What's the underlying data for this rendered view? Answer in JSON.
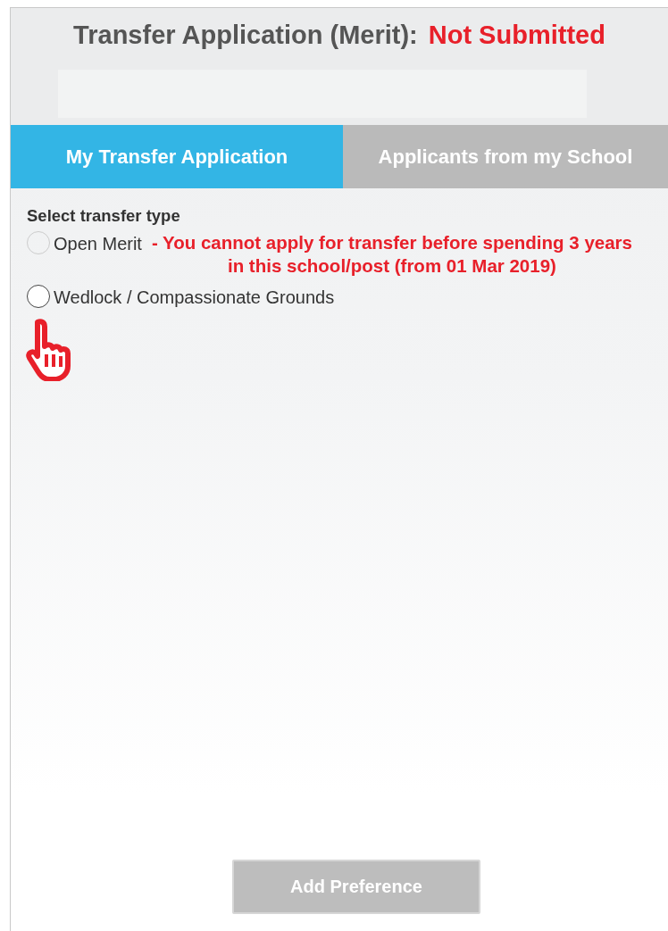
{
  "header": {
    "title": "Transfer Application (Merit):",
    "status": "Not Submitted"
  },
  "tabs": [
    {
      "label": "My Transfer Application",
      "selected": true
    },
    {
      "label": "Applicants from my School",
      "selected": false
    }
  ],
  "form": {
    "label": "Select transfer type",
    "options": [
      {
        "label": "Open Merit",
        "selected": false,
        "disabled": true,
        "warning": "- You cannot apply for transfer before spending 3 years in this school/post (from 01 Mar 2019)"
      },
      {
        "label": "Wedlock / Compassionate Grounds",
        "selected": false,
        "disabled": false
      }
    ]
  },
  "button": {
    "label": "Add Preference",
    "disabled": true
  }
}
